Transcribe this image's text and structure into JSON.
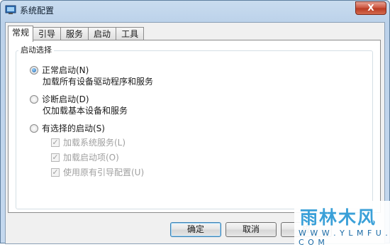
{
  "window": {
    "title": "系统配置",
    "close_label": "X"
  },
  "tabs": [
    {
      "label": "常规"
    },
    {
      "label": "引导"
    },
    {
      "label": "服务"
    },
    {
      "label": "启动"
    },
    {
      "label": "工具"
    }
  ],
  "startup_group": {
    "title": "启动选择",
    "options": [
      {
        "label": "正常启动(N)",
        "description": "加载所有设备驱动程序和服务",
        "selected": true
      },
      {
        "label": "诊断启动(D)",
        "description": "仅加载基本设备和服务",
        "selected": false
      },
      {
        "label": "有选择的启动(S)",
        "selected": false
      }
    ],
    "selective_items": [
      {
        "label": "加载系统服务(L)",
        "checked": true
      },
      {
        "label": "加载启动项(O)",
        "checked": true
      },
      {
        "label": "使用原有引导配置(U)",
        "checked": true
      }
    ]
  },
  "buttons": {
    "ok": "确定",
    "cancel": "取消",
    "apply_partial": "应"
  },
  "watermark": {
    "logo_text": "雨林木风",
    "url": "W W W . Y L M F U . C O M"
  }
}
